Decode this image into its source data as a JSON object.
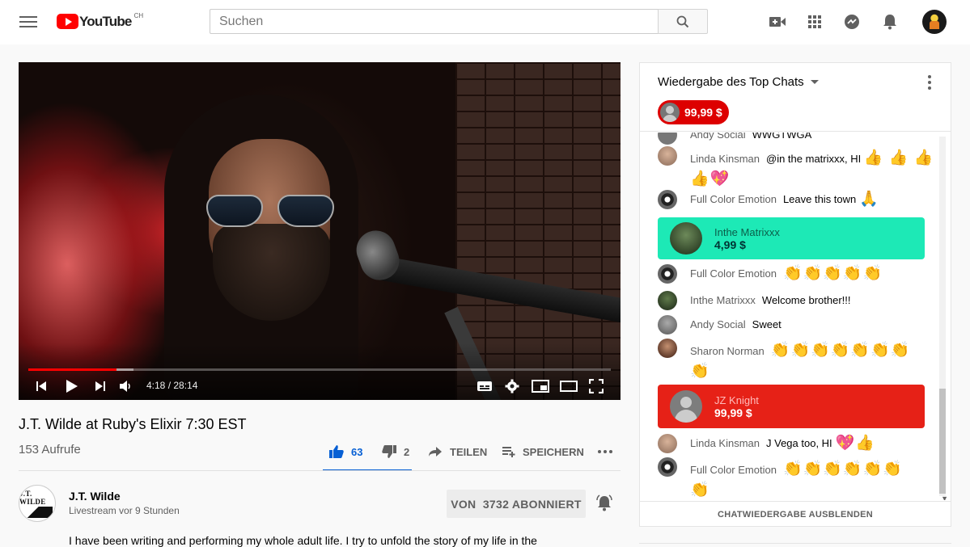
{
  "header": {
    "logo_text": "YouTube",
    "country_code": "CH",
    "search_placeholder": "Suchen"
  },
  "player": {
    "time_display": "4:18 / 28:14",
    "progress_fraction": 0.152,
    "buffer_fraction": 0.18
  },
  "video": {
    "title": "J.T. Wilde at Ruby's Elixir 7:30 EST",
    "views": "153 Aufrufe",
    "likes": "63",
    "dislikes": "2",
    "share_label": "TEILEN",
    "save_label": "SPEICHERN"
  },
  "channel": {
    "avatar_text": "J.T. WILDE",
    "name": "J.T. Wilde",
    "subtitle": "Livestream vor 9 Stunden",
    "subscribe_label": "VON  3732 ABONNIERT"
  },
  "description": "I have been writing and performing my whole adult life. I try to unfold the story of my life in the",
  "chat": {
    "title": "Wiedergabe des Top Chats",
    "ticker_amount": "99,99 $",
    "hide_label": "CHATWIEDERGABE AUSBLENDEN",
    "messages": [
      {
        "author": "Andy Social",
        "text": "WWGTWGA"
      },
      {
        "author": "Linda Kinsman",
        "text": "@in the matrixxx, HI",
        "emoji": "👍 👍 👍",
        "emoji2": "👍💖"
      },
      {
        "author": "Full Color Emotion",
        "text": "Leave this town",
        "emoji": "🙏"
      },
      {
        "author": "Full Color Emotion",
        "text": "",
        "emoji": "👏👏👏👏👏"
      },
      {
        "author": "Inthe Matrixxx",
        "text": "Welcome brother!!!"
      },
      {
        "author": "Andy Social",
        "text": "Sweet"
      },
      {
        "author": "Sharon Norman",
        "text": "",
        "emoji": "👏👏👏👏👏👏👏",
        "emoji2": "👏"
      },
      {
        "author": "Linda Kinsman",
        "text": "J Vega too, HI",
        "emoji": "💖👍"
      },
      {
        "author": "Full Color Emotion",
        "text": "",
        "emoji": "👏👏👏👏👏👏",
        "emoji2": "👏"
      }
    ],
    "superchats": [
      {
        "author": "Inthe Matrixxx",
        "amount": "4,99 $",
        "color": "#1de9b6"
      },
      {
        "author": "JZ Knight",
        "amount": "99,99 $",
        "color": "#e62117"
      }
    ]
  }
}
